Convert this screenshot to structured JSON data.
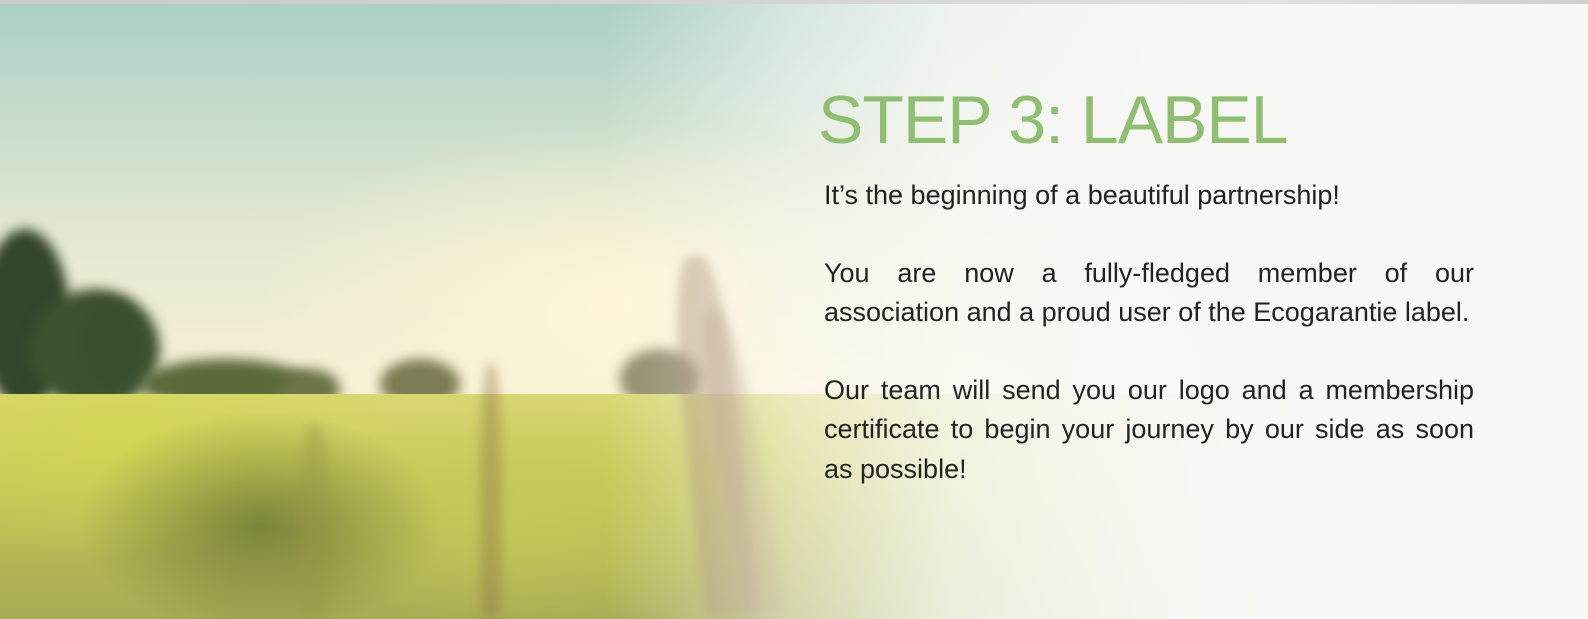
{
  "section": {
    "title": "STEP 3: LABEL",
    "intro": "It’s the beginning of a beautiful partnership!",
    "paragraph_1": "You are now a fully-fledged member of our association and a proud user of the Ecogarantie label.",
    "paragraph_2": "Our team will send you our logo and a membership certificate to begin your journey by our side as soon as possible!"
  },
  "colors": {
    "title": "#8dbf6e",
    "text": "#222222",
    "panel": "#f7f7f5"
  },
  "background": {
    "image": "wheat-field-sunset"
  }
}
